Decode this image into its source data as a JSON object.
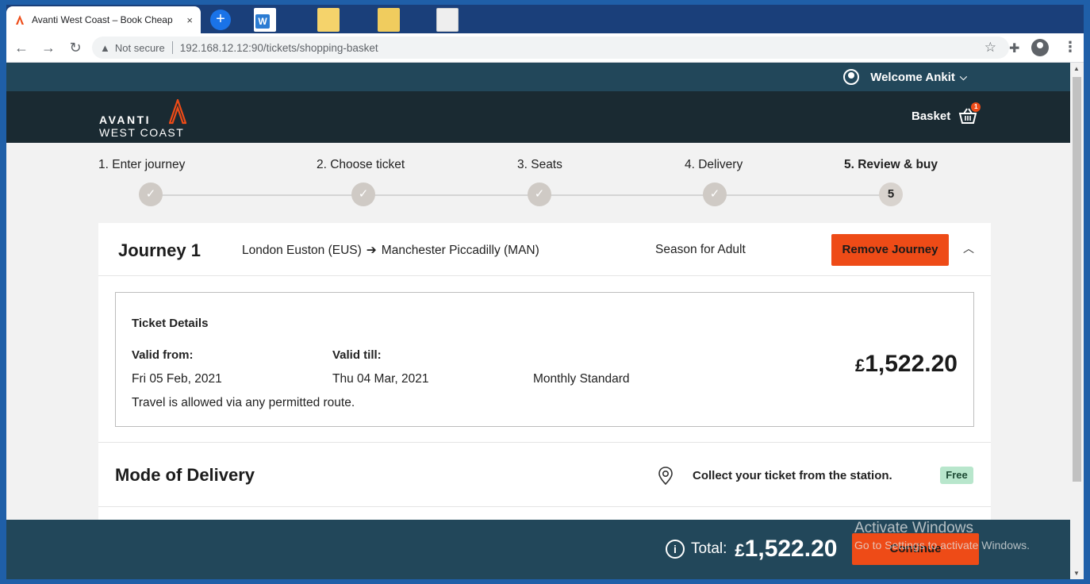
{
  "browser": {
    "tab_title": "Avanti West Coast – Book Cheap",
    "tab_close": "×",
    "new_tab": "+",
    "security_label": "Not secure",
    "url": "192.168.12.12:90/tickets/shopping-basket",
    "back": "←",
    "forward": "→",
    "reload": "↻",
    "star": "☆",
    "menu": "⋮"
  },
  "header": {
    "welcome": "Welcome Ankit",
    "brand_top": "AVANTI",
    "brand_bottom": "WEST COAST",
    "basket_label": "Basket",
    "basket_count": "1"
  },
  "steps": [
    {
      "label": "1. Enter journey",
      "state": "done"
    },
    {
      "label": "2. Choose ticket",
      "state": "done"
    },
    {
      "label": "3. Seats",
      "state": "done"
    },
    {
      "label": "4. Delivery",
      "state": "done"
    },
    {
      "label": "5. Review & buy",
      "state": "current",
      "number": "5"
    }
  ],
  "journey": {
    "title": "Journey 1",
    "origin": "London Euston (EUS)",
    "destination": "Manchester Piccadilly (MAN)",
    "ticket_type": "Season for Adult",
    "remove_label": "Remove Journey",
    "ticket_details_heading": "Ticket Details",
    "valid_from_label": "Valid from:",
    "valid_from": "Fri 05 Feb, 2021",
    "valid_till_label": "Valid till:",
    "valid_till": "Thu 04 Mar, 2021",
    "ticket_class": "Monthly Standard",
    "route_note": "Travel is allowed via any permitted route.",
    "price_currency": "£",
    "price": "1,522.20"
  },
  "delivery": {
    "title": "Mode of Delivery",
    "method": "Collect your ticket from the station.",
    "cost": "Free"
  },
  "footer": {
    "total_label": "Total:",
    "total_currency": "£",
    "total": "1,522.20",
    "continue_label": "Continue"
  },
  "watermark": {
    "line1": "Activate Windows",
    "line2": "Go to Settings to activate Windows."
  },
  "colors": {
    "accent": "#ee4b17",
    "header_teal": "#22475a",
    "brand_dark": "#1a2a32",
    "free_badge": "#b8e6cc"
  }
}
